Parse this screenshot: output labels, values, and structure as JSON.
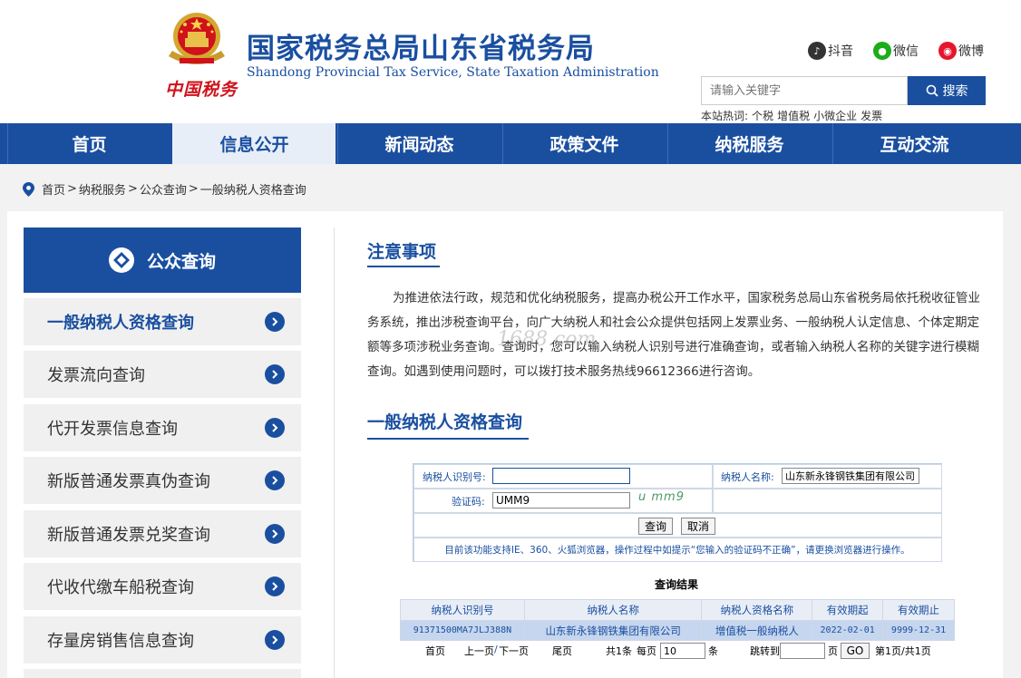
{
  "header": {
    "slogan": "中国税务",
    "title": "国家税务总局山东省税务局",
    "subtitle": "Shandong Provincial Tax Service, State Taxation Administration",
    "social": [
      {
        "label": "抖音",
        "icon": "douyin-icon",
        "color": "#333333"
      },
      {
        "label": "微信",
        "icon": "wechat-icon",
        "color": "#1aad19"
      },
      {
        "label": "微博",
        "icon": "weibo-icon",
        "color": "#e6162d"
      }
    ],
    "search": {
      "placeholder": "请输入关键字",
      "button_label": "搜索"
    },
    "hotwords": {
      "label": "本站热词:",
      "items": [
        "个税",
        "增值税",
        "小微企业",
        "发票"
      ]
    }
  },
  "nav": {
    "items": [
      "首页",
      "信息公开",
      "新闻动态",
      "政策文件",
      "纳税服务",
      "互动交流"
    ],
    "active_index": 1
  },
  "breadcrumb": [
    "首页",
    "纳税服务",
    "公众查询",
    "一般纳税人资格查询"
  ],
  "sidebar": {
    "title": "公众查询",
    "items": [
      {
        "label": "一般纳税人资格查询",
        "active": true
      },
      {
        "label": "发票流向查询"
      },
      {
        "label": "代开发票信息查询"
      },
      {
        "label": "新版普通发票真伪查询"
      },
      {
        "label": "新版普通发票兑奖查询"
      },
      {
        "label": "代收代缴车船税查询"
      },
      {
        "label": "存量房销售信息查询"
      }
    ]
  },
  "notice": {
    "title": "注意事项",
    "body": "为推进依法行政，规范和优化纳税服务，提高办税公开工作水平，国家税务总局山东省税务局依托税收征管业务系统，推出涉税查询平台，向广大纳税人和社会公众提供包括网上发票业务、一般纳税人认定信息、个体定期定额等多项涉税业务查询。查询时，您可以输入纳税人识别号进行准确查询，或者输入纳税人名称的关键字进行模糊查询。如遇到使用问题时，可以拨打技术服务热线96612366进行咨询。",
    "watermark": "1688.com"
  },
  "query": {
    "title": "一般纳税人资格查询",
    "taxpayer_id_label": "纳税人识别号:",
    "taxpayer_id_value": "",
    "taxpayer_name_label": "纳税人名称:",
    "taxpayer_name_value": "山东新永锋钢铁集团有限公司",
    "captcha_label": "验证码:",
    "captcha_value": "UMM9",
    "captcha_image_text": "u mm9",
    "query_button": "查询",
    "cancel_button": "取消",
    "hint": "目前该功能支持IE、360、火狐浏览器，操作过程中如提示“您输入的验证码不正确”，请更换浏览器进行操作。"
  },
  "results": {
    "title": "查询结果",
    "columns": [
      "纳税人识别号",
      "纳税人名称",
      "纳税人资格名称",
      "有效期起",
      "有效期止"
    ],
    "rows": [
      [
        "91371500MA7JLJ388N",
        "山东新永锋钢铁集团有限公司",
        "增值税一般纳税人",
        "2022-02-01",
        "9999-12-31"
      ]
    ]
  },
  "pager": {
    "first": "首页",
    "prev": "上一页",
    "slash": "/",
    "next": "下一页",
    "last": "尾页",
    "total_text": "共1条",
    "per_page_label": "每页",
    "per_page_value": "10",
    "per_page_unit": "条",
    "jump_label": "跳转到",
    "jump_value": "",
    "page_unit": "页",
    "go_button": "GO",
    "page_status": "第1页/共1页"
  }
}
